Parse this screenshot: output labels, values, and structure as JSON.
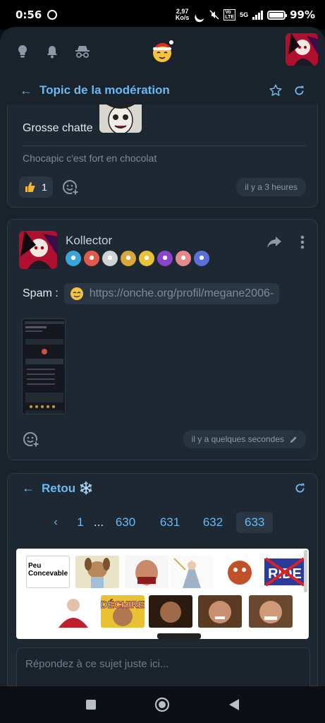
{
  "status_bar": {
    "time": "0:56",
    "speed_value": "2,97",
    "speed_unit": "Ko/s",
    "network": "5G",
    "battery_pct": "99%",
    "battery_level": 0.99
  },
  "topbar": {
    "icons": [
      "lightbulb-icon",
      "bell-icon",
      "incognito-icon"
    ]
  },
  "topic": {
    "title": "Topic de la modération"
  },
  "post_previous": {
    "text": "Grosse chatte",
    "signature": "Chocapic c'est fort en chocolat",
    "like_count": "1",
    "time": "il y a 3 heures"
  },
  "post_main": {
    "username": "Kollector",
    "badge_colors": [
      "#3aa6d8",
      "#e05a4a",
      "#cfd3d8",
      "#d8a73a",
      "#e6c234",
      "#8a44c8",
      "#e58a8a",
      "#5b6fd8"
    ],
    "text_prefix": "Spam :",
    "link": "https://onche.org/profil/megane2006-",
    "time": "il y a quelques secondes"
  },
  "reply": {
    "title": "Retou ❄️",
    "pages": [
      "1",
      "...",
      "630",
      "631",
      "632",
      "633"
    ],
    "active_page": "633",
    "stickers": [
      {
        "name": "peu-concevable",
        "line1": "Peu",
        "line2": "Concevable"
      },
      {
        "name": "dechire",
        "label": "DÉCHIRE"
      },
      {
        "name": "ride",
        "label": "RIDE"
      }
    ],
    "placeholder": "Répondez à ce sujet juste ici..."
  }
}
